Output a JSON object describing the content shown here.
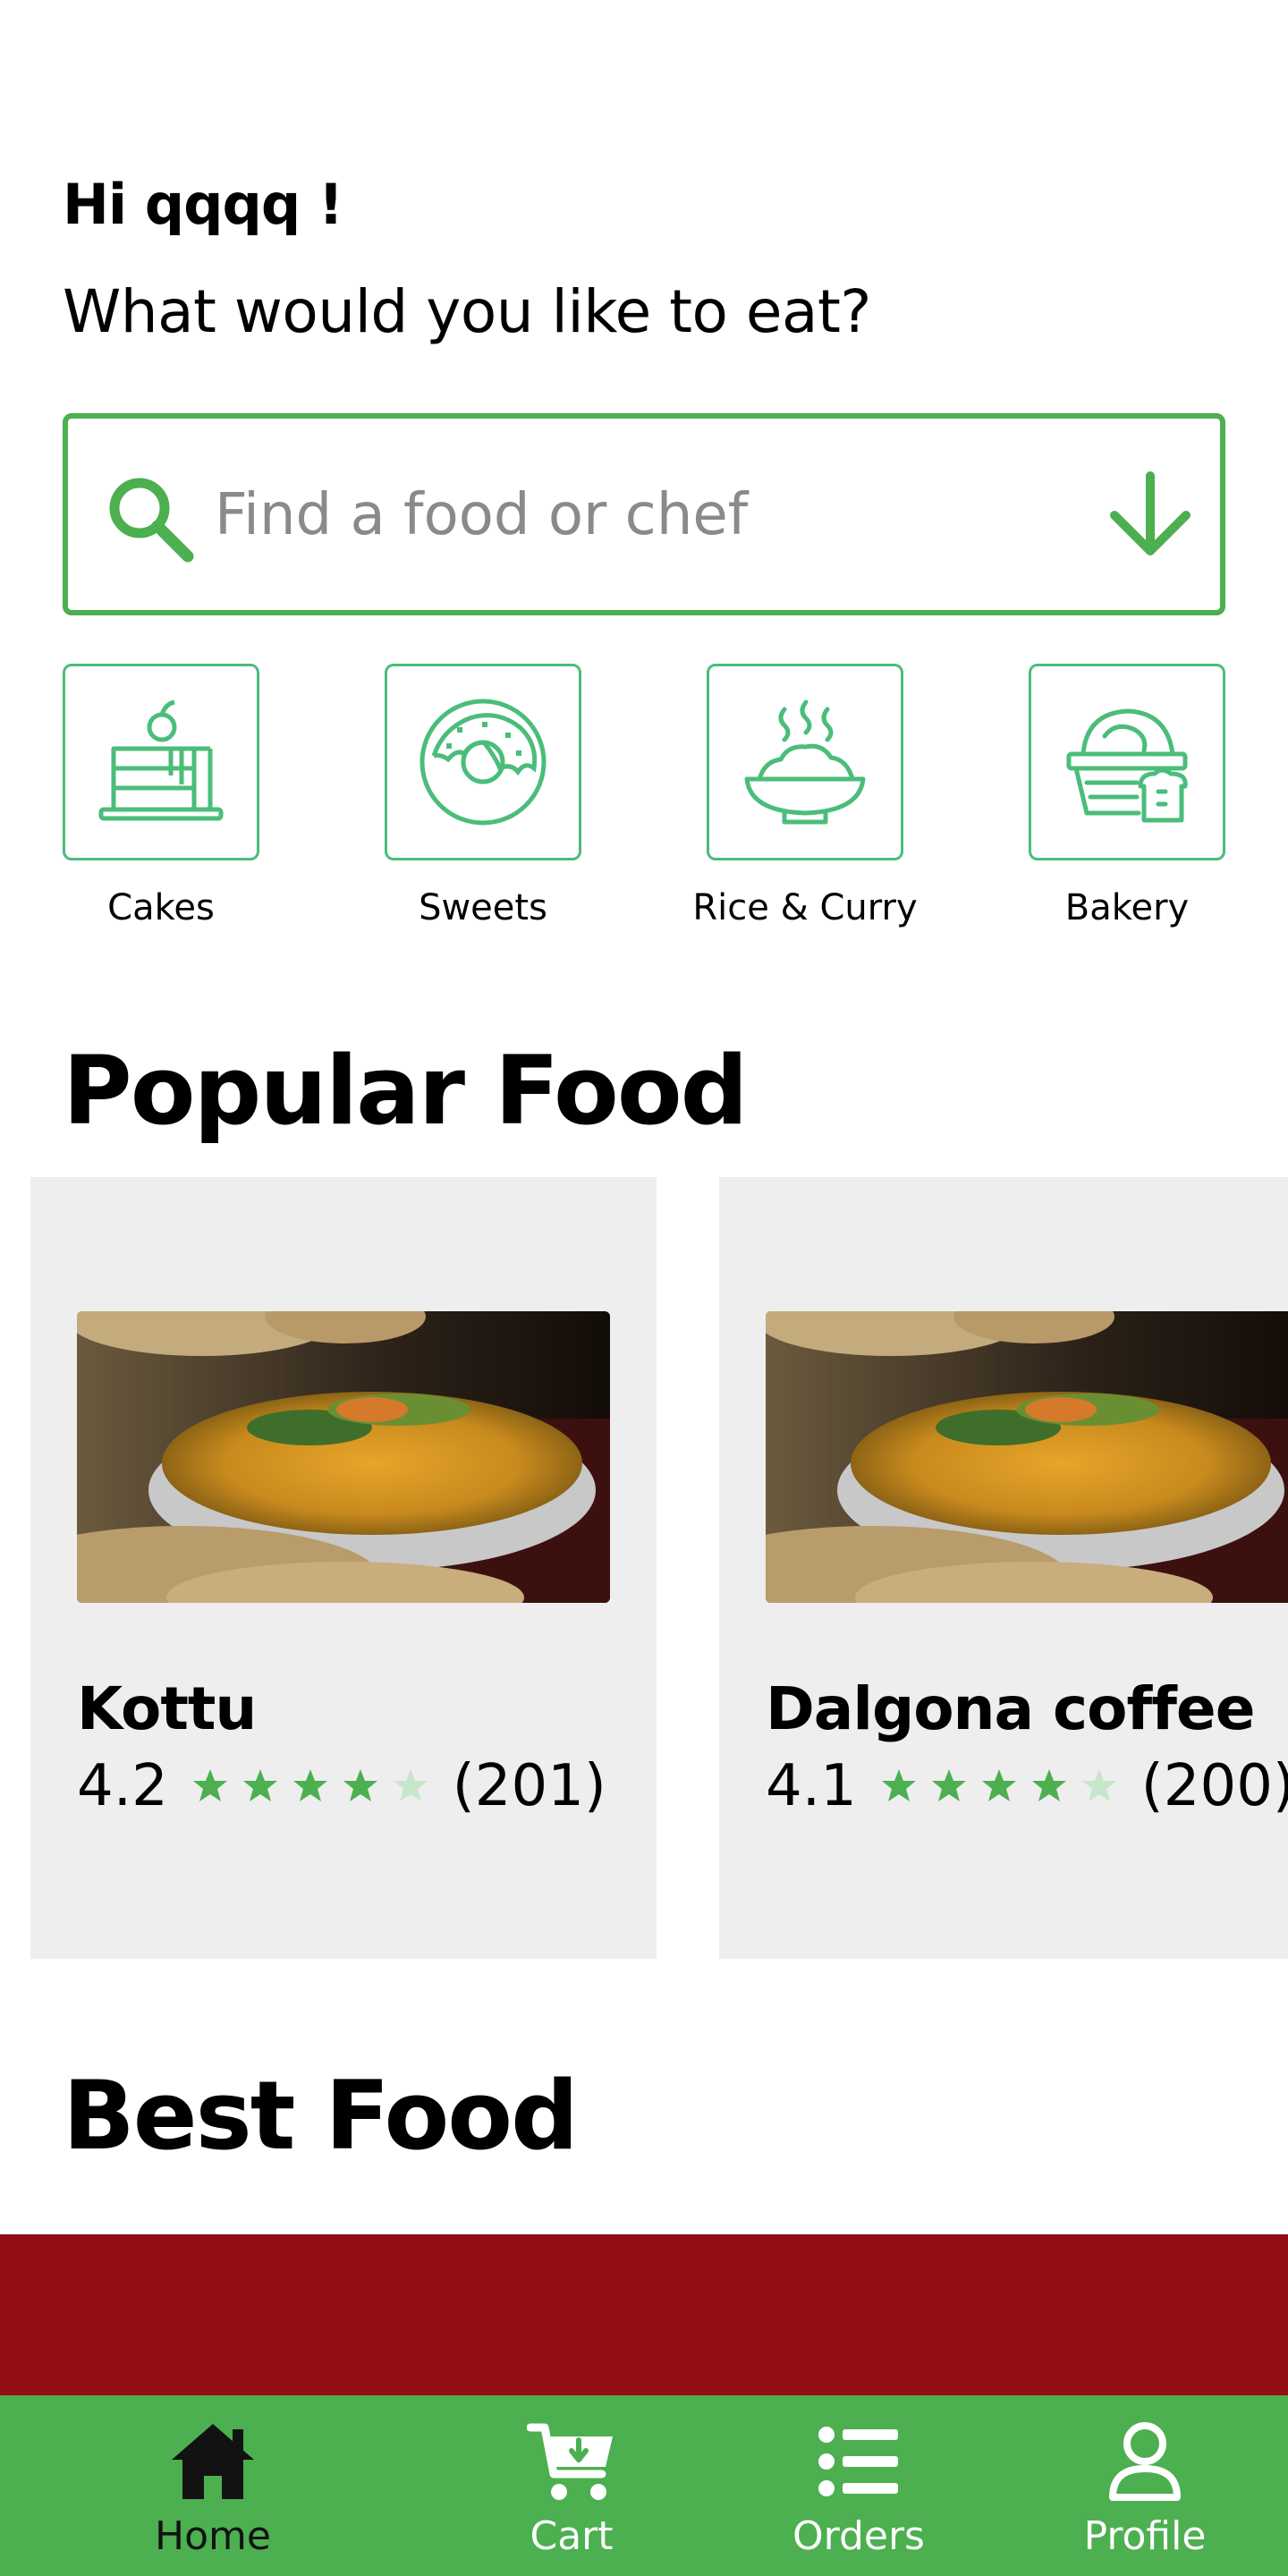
{
  "header": {
    "greeting": "Hi qqqq !",
    "subtitle": "What would you like to eat?"
  },
  "search": {
    "placeholder": "Find a food or chef",
    "value": "",
    "search_icon": "search-icon",
    "dropdown_icon": "arrow-down-icon"
  },
  "categories": [
    {
      "label": "Cakes",
      "icon": "cake-icon"
    },
    {
      "label": "Sweets",
      "icon": "donut-icon"
    },
    {
      "label": "Rice & Curry",
      "icon": "rice-bowl-icon"
    },
    {
      "label": "Bakery",
      "icon": "bakery-basket-icon"
    }
  ],
  "sections": {
    "popular_title": "Popular Food",
    "best_title": "Best Food"
  },
  "popular_food": [
    {
      "name": "Kottu",
      "rating": "4.2",
      "rating_stars": 4.2,
      "count": "(201)"
    },
    {
      "name": "Dalgona coffee",
      "rating": "4.1",
      "rating_stars": 4.1,
      "count": "(200)"
    }
  ],
  "bottom_nav": [
    {
      "label": "Home",
      "icon": "home-icon",
      "active": true
    },
    {
      "label": "Cart",
      "icon": "cart-icon",
      "active": false
    },
    {
      "label": "Orders",
      "icon": "list-icon",
      "active": false
    },
    {
      "label": "Profile",
      "icon": "user-icon",
      "active": false
    }
  ],
  "colors": {
    "accent": "#4caf50",
    "category_outline": "#4bbd7a",
    "star_filled": "#4caf50",
    "star_empty": "#c8e6c9",
    "card_background": "#eeeeee",
    "banner": "#930e14",
    "nav_active": "#121212",
    "nav_inactive": "#ffffff"
  }
}
